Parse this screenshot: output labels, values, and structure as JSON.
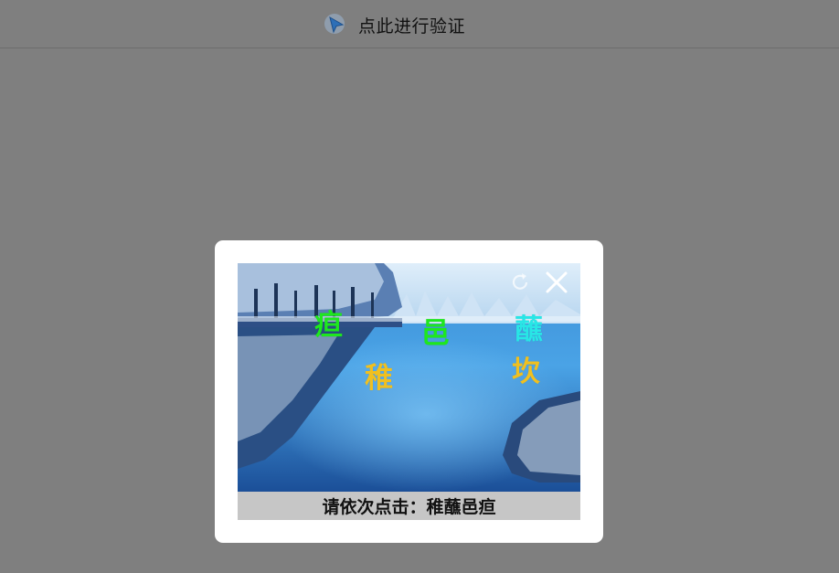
{
  "header": {
    "verify_label": "点此进行验证",
    "icon": "cursor-arrow-icon"
  },
  "captcha": {
    "controls": {
      "refresh_icon": "refresh-icon",
      "close_icon": "close-icon"
    },
    "glyphs": [
      {
        "char": "疸",
        "color": "#1ee81e"
      },
      {
        "char": "邑",
        "color": "#1ee81e"
      },
      {
        "char": "蘸",
        "color": "#28e6e6"
      },
      {
        "char": "稚",
        "color": "#f0c020"
      },
      {
        "char": "坎",
        "color": "#f0c020"
      }
    ],
    "instruction": "请依次点击：稚蘸邑疸"
  }
}
